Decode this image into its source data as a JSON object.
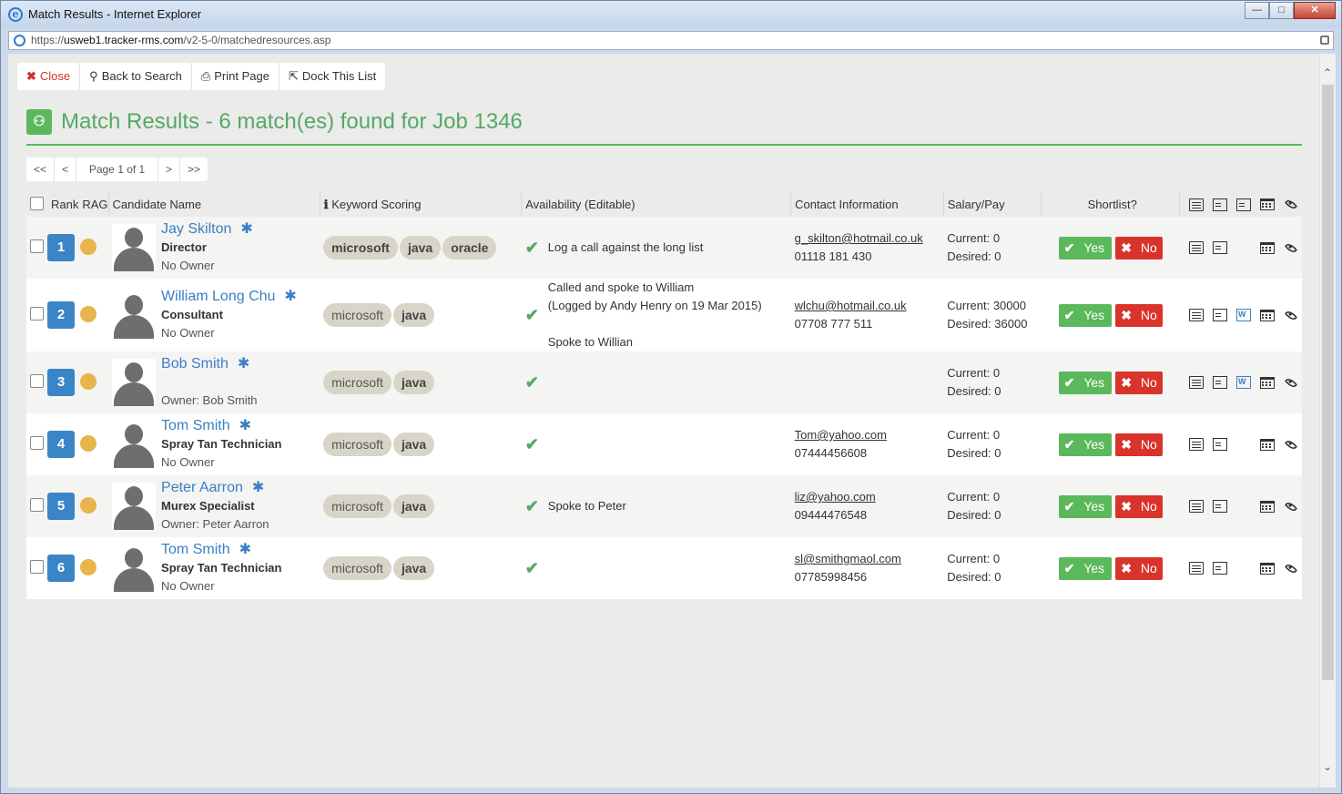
{
  "window": {
    "title": "Match Results - Internet Explorer",
    "minimize": "—",
    "maximize": "□",
    "close": "✕"
  },
  "address": {
    "prefix": "https://",
    "domain": "usweb1.tracker-rms.com",
    "path": "/v2-5-0/matchedresources.asp"
  },
  "toolbar": {
    "close": "Close",
    "back": "Back to Search",
    "print": "Print Page",
    "dock": "Dock This List"
  },
  "heading": "Match Results - 6 match(es) found for Job 1346",
  "pager": {
    "first": "<<",
    "prev": "<",
    "info": "Page 1 of 1",
    "next": ">",
    "last": ">>"
  },
  "columns": {
    "rank": "Rank",
    "rag": "RAG",
    "name": "Candidate Name",
    "keyword": "Keyword Scoring",
    "availability": "Availability (Editable)",
    "contact": "Contact Information",
    "salary": "Salary/Pay",
    "shortlist": "Shortlist?"
  },
  "buttons": {
    "yes": "Yes",
    "no": "No"
  },
  "colors": {
    "accent_green": "#55a865",
    "rank_blue": "#3a85c6",
    "rag_amber": "#e8b54c",
    "no_red": "#d9342b"
  },
  "rows": [
    {
      "rank": "1",
      "name": "Jay Skilton",
      "title": "Director",
      "owner": "No Owner",
      "keywords": [
        "microsoft",
        "java",
        "oracle"
      ],
      "avail1": "Log a call against the long list",
      "avail2": "",
      "avail3": "",
      "email": "g_skilton@hotmail.co.uk",
      "phone": "01118 181 430",
      "current": "Current: 0",
      "desired": "Desired: 0",
      "word": false
    },
    {
      "rank": "2",
      "name": "William Long Chu",
      "title": "Consultant",
      "owner": "No Owner",
      "keywords": [
        "microsoft",
        "java"
      ],
      "avail1": "Called and spoke to William",
      "avail2": "(Logged by Andy Henry on 19 Mar 2015)",
      "avail3": "Spoke to Willian",
      "email": "wlchu@hotmail.co.uk",
      "phone": "07708 777 511",
      "current": "Current: 30000",
      "desired": "Desired: 36000",
      "word": true
    },
    {
      "rank": "3",
      "name": "Bob Smith",
      "title": "",
      "owner": "Owner: Bob Smith",
      "keywords": [
        "microsoft",
        "java"
      ],
      "avail1": "",
      "avail2": "",
      "avail3": "",
      "email": "",
      "phone": "",
      "current": "Current: 0",
      "desired": "Desired: 0",
      "word": true
    },
    {
      "rank": "4",
      "name": "Tom Smith",
      "title": "Spray Tan Technician",
      "owner": "No Owner",
      "keywords": [
        "microsoft",
        "java"
      ],
      "avail1": "",
      "avail2": "",
      "avail3": "",
      "email": "Tom@yahoo.com",
      "phone": "07444456608",
      "current": "Current: 0",
      "desired": "Desired: 0",
      "word": false
    },
    {
      "rank": "5",
      "name": "Peter Aarron",
      "title": "Murex Specialist",
      "owner": "Owner: Peter Aarron",
      "keywords": [
        "microsoft",
        "java"
      ],
      "avail1": "Spoke to Peter",
      "avail2": "",
      "avail3": "",
      "email": "liz@yahoo.com",
      "phone": "09444476548",
      "current": "Current: 0",
      "desired": "Desired: 0",
      "word": false
    },
    {
      "rank": "6",
      "name": "Tom Smith",
      "title": "Spray Tan Technician",
      "owner": "No Owner",
      "keywords": [
        "microsoft",
        "java"
      ],
      "avail1": "",
      "avail2": "",
      "avail3": "",
      "email": "sl@smithgmaol.com",
      "phone": "07785998456",
      "current": "Current: 0",
      "desired": "Desired: 0",
      "word": false
    }
  ]
}
